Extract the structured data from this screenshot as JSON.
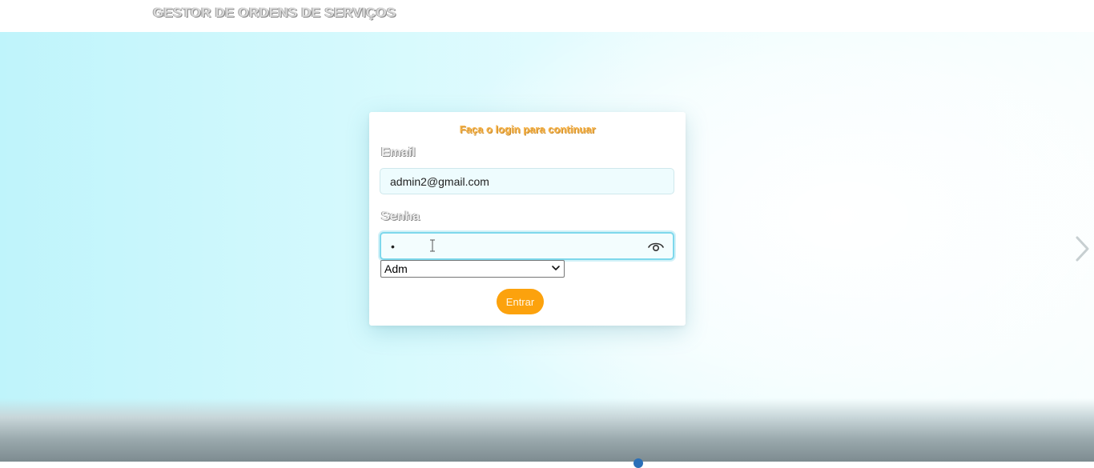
{
  "app": {
    "title": "GESTOR DE ORDENS DE SERVIÇOS"
  },
  "login": {
    "heading": "Faça o login para continuar",
    "email_label": "Email",
    "email_value": "admin2@gmail.com",
    "password_label": "Senha",
    "password_value": "•",
    "role_selected": "Adm",
    "submit_label": "Entrar"
  },
  "icons": {
    "password_toggle": "eye-icon",
    "carousel_next": "chevron-right-icon",
    "select_arrow": "chevron-down-icon",
    "mouse_cursor": "text-cursor-icon"
  },
  "colors": {
    "accent_orange": "#fca20d",
    "heading_orange": "#f7b44b",
    "focus_border": "#7ed8ec",
    "background_cyan": "#bff4fb"
  }
}
